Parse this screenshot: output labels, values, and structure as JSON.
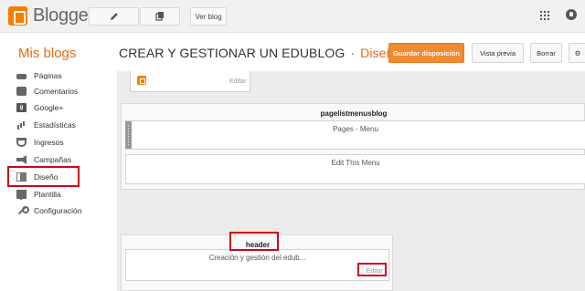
{
  "topbar": {
    "brand": "Blogger",
    "view_blog_label": "Ver blog"
  },
  "header": {
    "my_blogs": "Mis blogs",
    "blog_title": "CREAR Y GESTIONAR UN EDUBLOG",
    "separator": "·",
    "section": "Diseño",
    "save_label": "Guardar disposición",
    "preview_label": "Vista previa",
    "delete_label": "Borrar",
    "more_label": "⚙"
  },
  "sidebar": {
    "items": [
      {
        "label": "Páginas",
        "icon": "pages-icon"
      },
      {
        "label": "Comentarios",
        "icon": "comment-icon"
      },
      {
        "label": "Google+",
        "icon": "google-plus-icon"
      },
      {
        "label": "Estadísticas",
        "icon": "stats-icon"
      },
      {
        "label": "Ingresos",
        "icon": "trophy-icon"
      },
      {
        "label": "Campañas",
        "icon": "megaphone-icon"
      },
      {
        "label": "Diseño",
        "icon": "layout-icon",
        "active": true
      },
      {
        "label": "Plantilla",
        "icon": "paint-roller-icon"
      },
      {
        "label": "Configuración",
        "icon": "wrench-icon"
      }
    ]
  },
  "canvas": {
    "attribution": {
      "edit_label": "Editar"
    },
    "pages_section": {
      "title": "pagelistmenusblog",
      "widgets": [
        {
          "label": "Pages - Menu"
        },
        {
          "label": "Edit This Menu"
        }
      ]
    },
    "header_section": {
      "title": "header",
      "widget_label": "Creación y gestión del edub...",
      "edit_label": "Editar"
    }
  },
  "colors": {
    "accent_orange": "#f28a31",
    "brand_orange": "#f57d00",
    "highlight_red": "#d0021b"
  }
}
